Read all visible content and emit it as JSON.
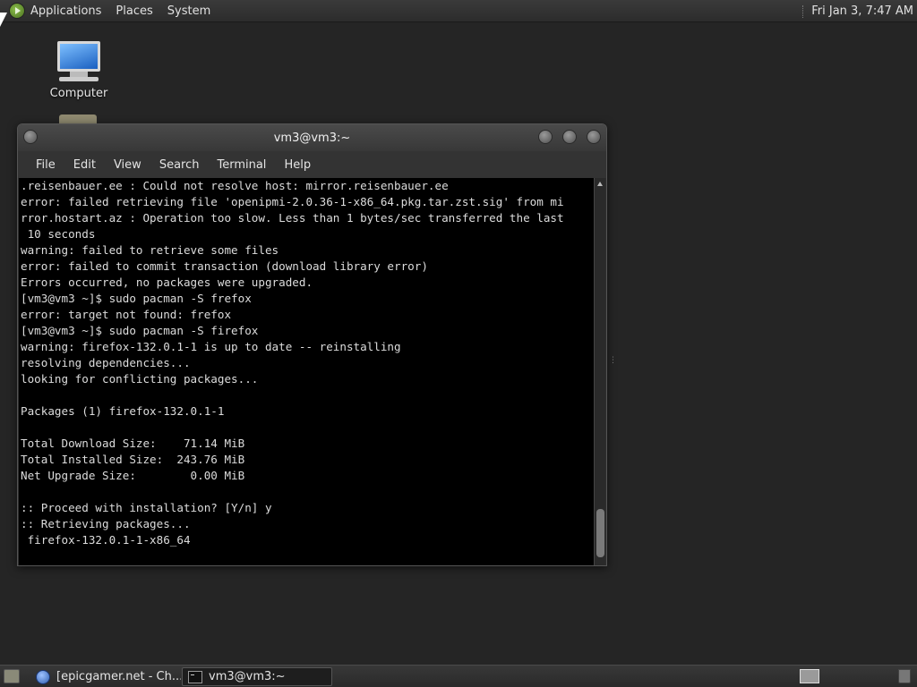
{
  "top_panel": {
    "menus": [
      "Applications",
      "Places",
      "System"
    ],
    "clock": "Fri Jan  3,  7:47 AM"
  },
  "desktop": {
    "icons": [
      {
        "label": "Computer",
        "icon": "computer-icon"
      },
      {
        "label": "",
        "icon": "folder-icon"
      }
    ]
  },
  "terminal": {
    "title": "vm3@vm3:~",
    "menu": [
      "File",
      "Edit",
      "View",
      "Search",
      "Terminal",
      "Help"
    ],
    "lines": [
      ".reisenbauer.ee : Could not resolve host: mirror.reisenbauer.ee",
      "error: failed retrieving file 'openipmi-2.0.36-1-x86_64.pkg.tar.zst.sig' from mi",
      "rror.hostart.az : Operation too slow. Less than 1 bytes/sec transferred the last",
      " 10 seconds",
      "warning: failed to retrieve some files",
      "error: failed to commit transaction (download library error)",
      "Errors occurred, no packages were upgraded.",
      "[vm3@vm3 ~]$ sudo pacman -S frefox",
      "error: target not found: frefox",
      "[vm3@vm3 ~]$ sudo pacman -S firefox",
      "warning: firefox-132.0.1-1 is up to date -- reinstalling",
      "resolving dependencies...",
      "looking for conflicting packages...",
      "",
      "Packages (1) firefox-132.0.1-1",
      "",
      "Total Download Size:    71.14 MiB",
      "Total Installed Size:  243.76 MiB",
      "Net Upgrade Size:        0.00 MiB",
      "",
      ":: Proceed with installation? [Y/n] y",
      ":: Retrieving packages...",
      " firefox-132.0.1-1-x86_64"
    ]
  },
  "taskbar": {
    "tasks": [
      {
        "label": "[epicgamer.net - Ch...",
        "icon": "browser-icon",
        "active": false
      },
      {
        "label": "vm3@vm3:~",
        "icon": "terminal-icon",
        "active": true
      }
    ]
  }
}
